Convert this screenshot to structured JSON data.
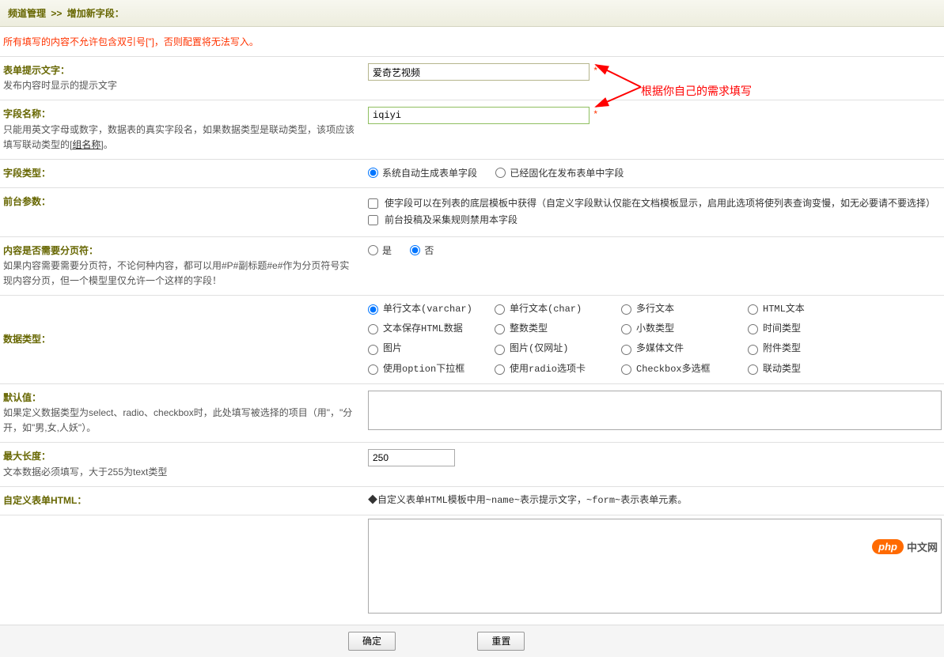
{
  "header": {
    "breadcrumb_a": "频道管理",
    "sep": ">>",
    "breadcrumb_b": "增加新字段："
  },
  "warning": "所有填写的内容不允许包含双引号[\"]，否则配置将无法写入。",
  "annotation_text": "根据你自己的需求填写",
  "rows": {
    "label1_title": "表单提示文字：",
    "label1_desc": "发布内容时显示的提示文字",
    "input1_value": "爱奇艺视频",
    "label2_title": "字段名称：",
    "label2_desc_a": "只能用英文字母或数字，数据表的真实字段名，如果数据类型是联动类型，该项应该填写联动类型的[",
    "label2_desc_link": "组名称",
    "label2_desc_b": "]。",
    "input2_value": "iqiyi",
    "label3_title": "字段类型：",
    "radio3_a": "系统自动生成表单字段",
    "radio3_b": "已经固化在发布表单中字段",
    "label4_title": "前台参数：",
    "check4_a": "使字段可以在列表的底层模板中获得（自定义字段默认仅能在文档模板显示，启用此选项将使列表查询变慢，如无必要请不要选择）",
    "check4_b": "前台投稿及采集规则禁用本字段",
    "label5_title": "内容是否需要分页符：",
    "label5_desc": "如果内容需要需要分页符，不论何种内容，都可以用#P#副标题#e#作为分页符号实现内容分页，但一个模型里仅允许一个这样的字段！",
    "radio5_a": "是",
    "radio5_b": "否",
    "label6_title": "数据类型：",
    "dt": [
      "单行文本(varchar)",
      "单行文本(char)",
      "多行文本",
      "HTML文本",
      "文本保存HTML数据",
      "整数类型",
      "小数类型",
      "时间类型",
      "图片",
      "图片(仅网址)",
      "多媒体文件",
      "附件类型",
      "使用option下拉框",
      "使用radio选项卡",
      "Checkbox多选框",
      "联动类型"
    ],
    "label7_title": "默认值：",
    "label7_desc": "如果定义数据类型为select、radio、checkbox时，此处填写被选择的项目（用\"，\"分开，如\"男,女,人妖\"）。",
    "label8_title": "最大长度：",
    "label8_desc": "文本数据必须填写，大于255为text类型",
    "input8_value": "250",
    "label9_title": "自定义表单HTML：",
    "label9_hint": "◆自定义表单HTML模板中用~name~表示提示文字，~form~表示表单元素。"
  },
  "buttons": {
    "ok": "确定",
    "reset": "重置"
  },
  "logo": {
    "pill": "php",
    "text": "中文网"
  }
}
